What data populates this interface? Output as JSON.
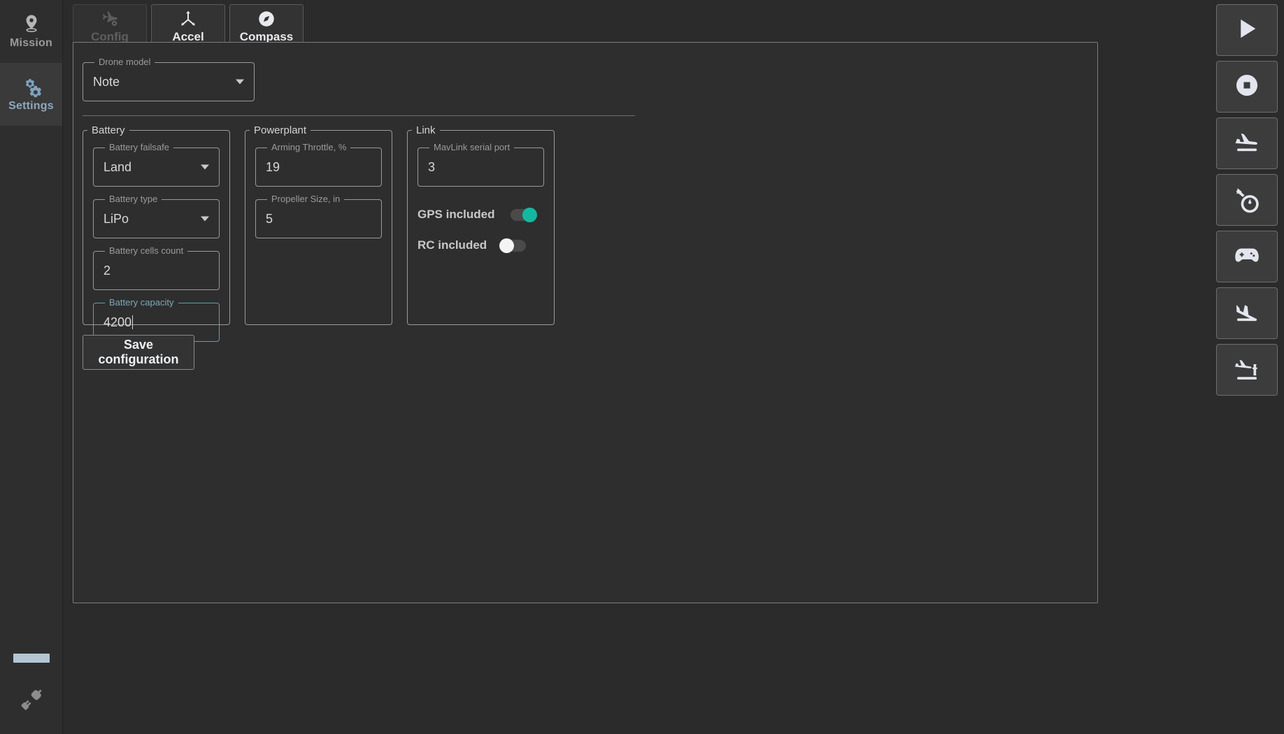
{
  "left_rail": {
    "items": [
      {
        "label": "Mission",
        "icon": "map-pin-icon",
        "active": false
      },
      {
        "label": "Settings",
        "icon": "gears-icon",
        "active": true
      }
    ],
    "status_bar": "",
    "connection_icon": "disconnected-plug-icon"
  },
  "tabs": [
    {
      "label": "Config",
      "icon": "plane-gear-icon",
      "state": "disabled"
    },
    {
      "label": "Accel",
      "icon": "axes-3d-icon",
      "state": "selected"
    },
    {
      "label": "Compass",
      "icon": "compass-icon",
      "state": "normal"
    }
  ],
  "drone_model": {
    "label": "Drone model",
    "value": "Note"
  },
  "battery": {
    "legend": "Battery",
    "fields": [
      {
        "label": "Battery failsafe",
        "value": "Land",
        "type": "select",
        "focused": false
      },
      {
        "label": "Battery type",
        "value": "LiPo",
        "type": "select",
        "focused": false
      },
      {
        "label": "Battery cells count",
        "value": "2",
        "type": "text",
        "focused": false
      },
      {
        "label": "Battery capacity",
        "value": "4200",
        "type": "text",
        "focused": true
      }
    ]
  },
  "powerplant": {
    "legend": "Powerplant",
    "fields": [
      {
        "label": "Arming Throttle, %",
        "value": "19",
        "type": "text",
        "focused": false
      },
      {
        "label": "Propeller Size, in",
        "value": "5",
        "type": "text",
        "focused": false
      }
    ]
  },
  "link": {
    "legend": "Link",
    "fields": [
      {
        "label": "MavLink serial port",
        "value": "3",
        "type": "text",
        "focused": false
      }
    ],
    "toggles": [
      {
        "label": "GPS included",
        "state": "on"
      },
      {
        "label": "RC included",
        "state": "off"
      }
    ]
  },
  "actions": {
    "save_label": "Save configuration"
  },
  "right_rail": {
    "buttons": [
      {
        "name": "play-button",
        "icon": "play-icon"
      },
      {
        "name": "stop-button",
        "icon": "stop-record-icon"
      },
      {
        "name": "takeoff-button",
        "icon": "plane-takeoff-icon"
      },
      {
        "name": "descend-speed-button",
        "icon": "gauge-arrow-down-icon"
      },
      {
        "name": "manual-control-button",
        "icon": "gamepad-icon"
      },
      {
        "name": "land-button",
        "icon": "plane-landing-icon"
      },
      {
        "name": "return-home-button",
        "icon": "plane-tower-icon"
      }
    ]
  },
  "colors": {
    "accent_on": "#14b8a0",
    "focus_border": "#6c9aae",
    "active_nav": "#8fa8bd",
    "status_bar": "#b3c5d2"
  }
}
